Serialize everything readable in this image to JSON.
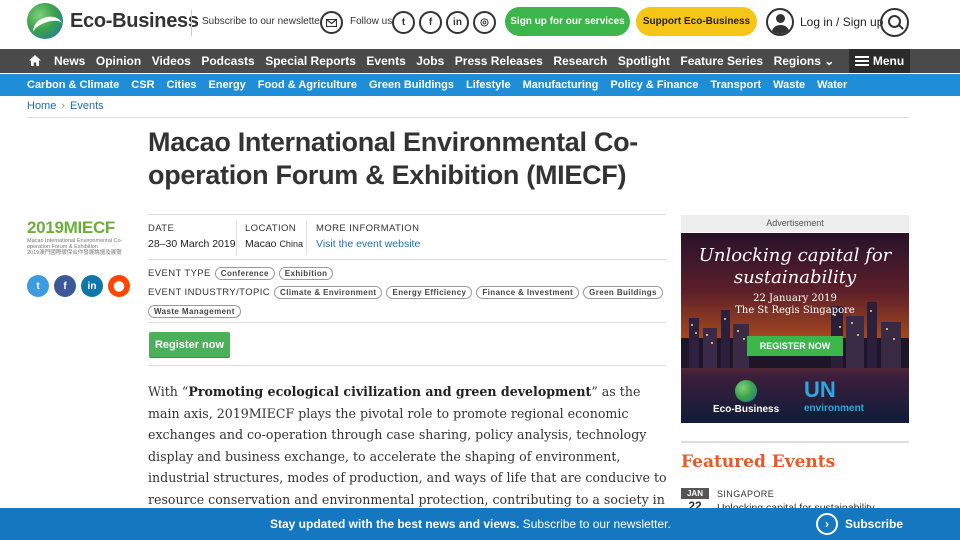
{
  "header": {
    "logo_text": "Eco-Business",
    "newsletter_label": "Subscribe to our newsletter",
    "follow_label": "Follow us",
    "signup_label": "Sign up for our services",
    "support_label": "Support Eco-Business",
    "login_label": "Log in / Sign up",
    "social": [
      "t",
      "f",
      "in",
      "◎"
    ]
  },
  "mainnav": {
    "items": [
      "News",
      "Opinion",
      "Videos",
      "Podcasts",
      "Special Reports",
      "Events",
      "Jobs",
      "Press Releases",
      "Research",
      "Spotlight",
      "Feature Series",
      "Regions ⌄"
    ],
    "menu_label": "Menu"
  },
  "subnav": {
    "items": [
      "Carbon & Climate",
      "CSR",
      "Cities",
      "Energy",
      "Food & Agriculture",
      "Green Buildings",
      "Lifestyle",
      "Manufacturing",
      "Policy & Finance",
      "Transport",
      "Waste",
      "Water"
    ]
  },
  "breadcrumb": {
    "home": "Home",
    "current": "Events"
  },
  "event": {
    "title": "Macao International Environmental Co-operation Forum & Exhibition (MIECF)",
    "logo_year": "2019",
    "logo_name": "MIECF",
    "logo_sub_en": "Macao International Environmental Co-operation Forum & Exhibition",
    "logo_sub_zh": "2019澳門國際環保合作發展論壇及展覽",
    "date_label": "DATE",
    "date_value": "28–30 March 2019",
    "location_label": "LOCATION",
    "location_city": "Macao",
    "location_country": "China",
    "more_label": "MORE INFORMATION",
    "more_value": "Visit the event website",
    "type_label": "EVENT TYPE",
    "types": [
      "Conference",
      "Exhibition"
    ],
    "topic_label": "EVENT INDUSTRY/TOPIC",
    "topics": [
      "Climate & Environment",
      "Energy Efficiency",
      "Finance & Investment",
      "Green Buildings",
      "Waste Management"
    ],
    "register_label": "Register now",
    "body_prefix": "With “",
    "body_bold": "Promoting ecological civilization and green development",
    "body_rest": "” as the main axis, 2019MIECF plays the pivotal role to promote regional economic exchanges and co-operation through case sharing, policy analysis, technology display and business exchange, to accelerate the shaping of environment, industrial structures, modes of production, and ways of life that are conducive to resource conservation and environmental protection, contributing to a society in harmony with nature."
  },
  "share": [
    "t",
    "f",
    "in",
    "⬤"
  ],
  "sidebar": {
    "ad_label": "Advertisement",
    "ad_headline": "Unlocking capital for sustainability",
    "ad_date": "22 January 2019",
    "ad_venue": "The St Regis Singapore",
    "ad_button": "REGISTER NOW",
    "ad_brand": "Eco-Business",
    "ad_un": "UN",
    "ad_un_env": "environment",
    "featured_title": "Featured Events",
    "featured": {
      "month": "JAN",
      "day": "22",
      "location": "SINGAPORE",
      "name": "Unlocking capital for sustainability"
    }
  },
  "banner": {
    "message_bold": "Stay updated with the best news and views.",
    "message_rest": " Subscribe to our newsletter.",
    "subscribe_label": "Subscribe"
  },
  "colors": {
    "green": "#3cb54a",
    "yellow": "#f5c518",
    "dark_nav": "#4a4a4a",
    "blue_nav": "#1f8ed6",
    "banner": "#1577bf",
    "featured": "#e8582a"
  }
}
